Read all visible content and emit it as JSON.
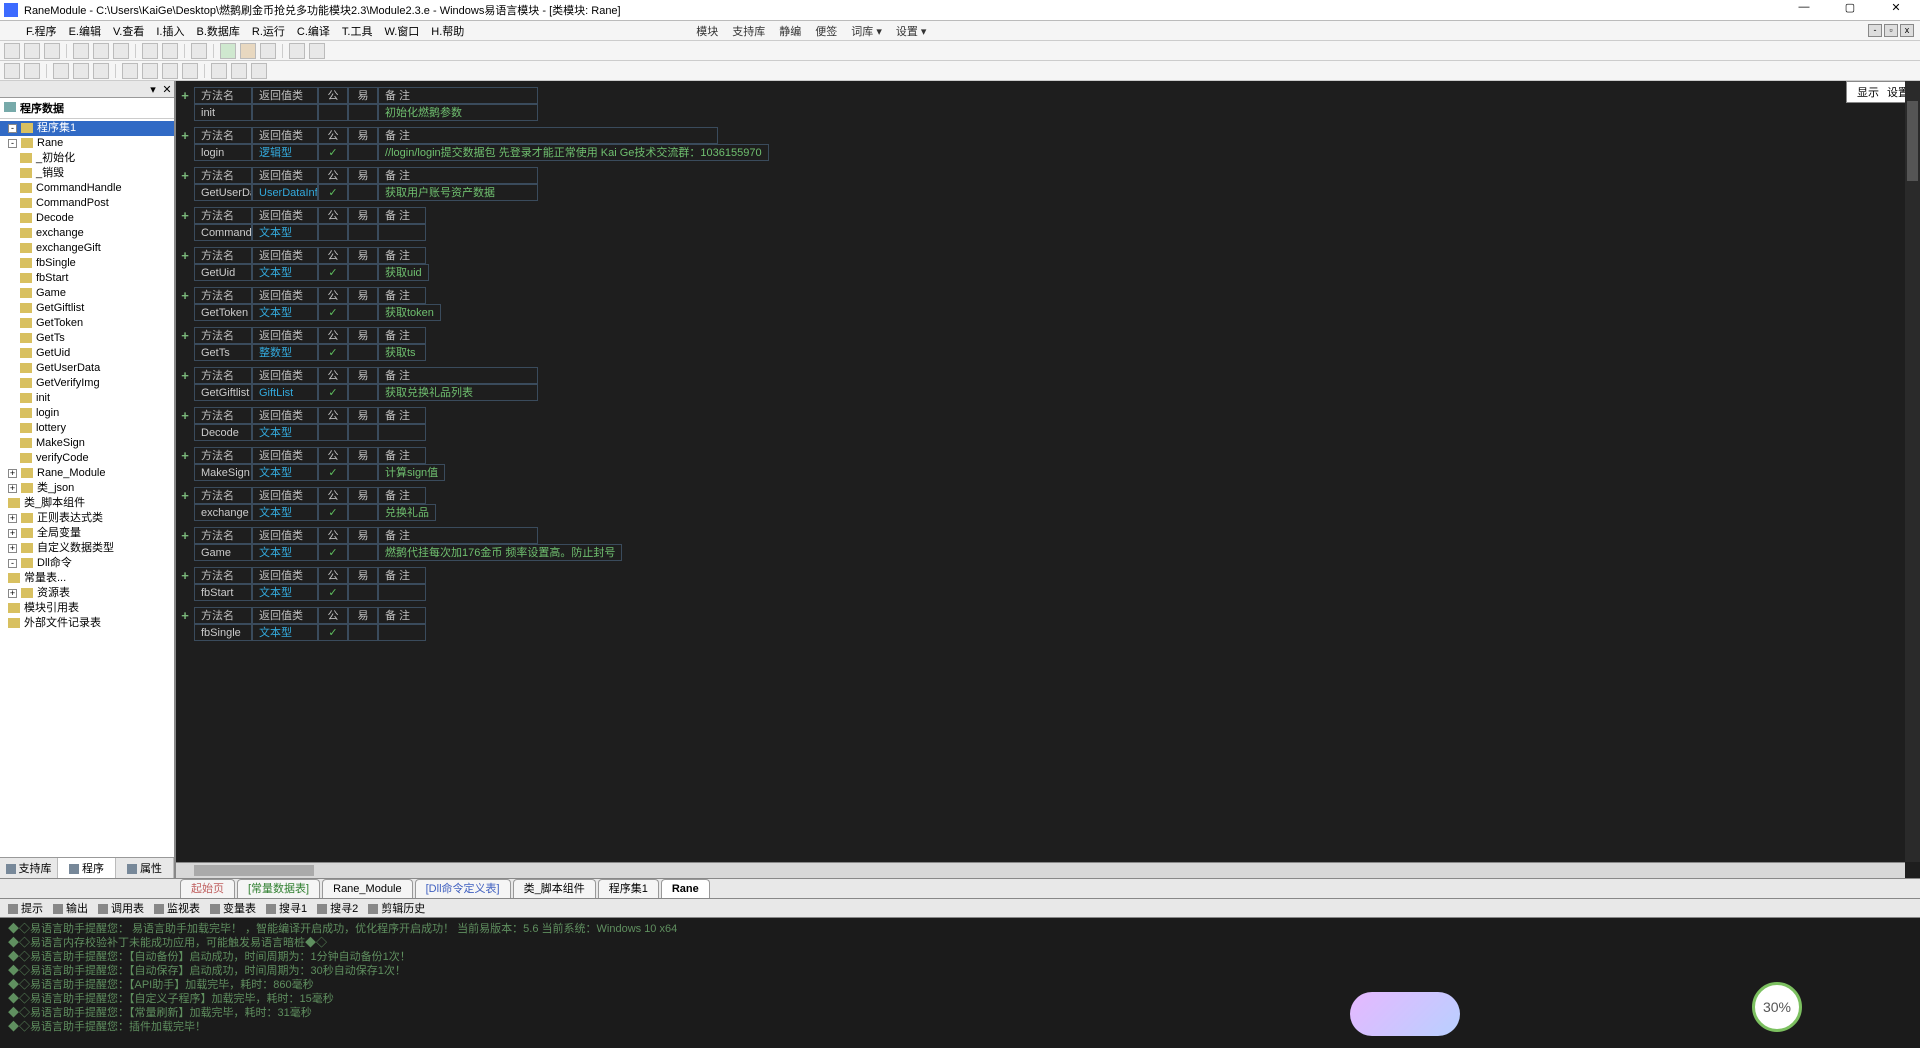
{
  "title": "RaneModule - C:\\Users\\KaiGe\\Desktop\\燃鹅刷金币抢兑多功能模块2.3\\Module2.3.e - Windows易语言模块 - [类模块: Rane]",
  "menu": {
    "items": [
      "F.程序",
      "E.编辑",
      "V.查看",
      "I.插入",
      "B.数据库",
      "R.运行",
      "C.编译",
      "T.工具",
      "W.窗口",
      "H.帮助"
    ],
    "items2": [
      "模块",
      "支持库",
      "静编",
      "便签",
      "词库 ▾",
      "设置 ▾"
    ]
  },
  "sysbtns": {
    "min": "—",
    "max": "▢",
    "close": "✕"
  },
  "side": {
    "title": "程序数据",
    "tabs": [
      "支持库",
      "程序",
      "属性"
    ],
    "tree": [
      {
        "lv": 0,
        "pm": "-",
        "t": "程序集1",
        "sel": true
      },
      {
        "lv": 0,
        "pm": "-",
        "t": "Rane"
      },
      {
        "lv": 1,
        "t": "_初始化"
      },
      {
        "lv": 1,
        "t": "_销毁"
      },
      {
        "lv": 1,
        "t": "CommandHandle"
      },
      {
        "lv": 1,
        "t": "CommandPost"
      },
      {
        "lv": 1,
        "t": "Decode"
      },
      {
        "lv": 1,
        "t": "exchange"
      },
      {
        "lv": 1,
        "t": "exchangeGift"
      },
      {
        "lv": 1,
        "t": "fbSingle"
      },
      {
        "lv": 1,
        "t": "fbStart"
      },
      {
        "lv": 1,
        "t": "Game"
      },
      {
        "lv": 1,
        "t": "GetGiftlist"
      },
      {
        "lv": 1,
        "t": "GetToken"
      },
      {
        "lv": 1,
        "t": "GetTs"
      },
      {
        "lv": 1,
        "t": "GetUid"
      },
      {
        "lv": 1,
        "t": "GetUserData"
      },
      {
        "lv": 1,
        "t": "GetVerifyImg"
      },
      {
        "lv": 1,
        "t": "init"
      },
      {
        "lv": 1,
        "t": "login"
      },
      {
        "lv": 1,
        "t": "lottery"
      },
      {
        "lv": 1,
        "t": "MakeSign"
      },
      {
        "lv": 1,
        "t": "verifyCode"
      },
      {
        "lv": 0,
        "pm": "+",
        "t": "Rane_Module"
      },
      {
        "lv": 0,
        "pm": "+",
        "t": "类_json"
      },
      {
        "lv": 0,
        "pm": "",
        "t": "类_脚本组件"
      },
      {
        "lv": 0,
        "pm": "+",
        "t": "正则表达式类"
      },
      {
        "lv": 0,
        "pm": "+",
        "t": "全局变量"
      },
      {
        "lv": 0,
        "pm": "+",
        "t": "自定义数据类型"
      },
      {
        "lv": 0,
        "pm": "-",
        "t": "Dll命令"
      },
      {
        "lv": 0,
        "pm": "",
        "t": "常量表..."
      },
      {
        "lv": 0,
        "pm": "+",
        "t": "资源表"
      },
      {
        "lv": 0,
        "pm": "",
        "t": "模块引用表"
      },
      {
        "lv": 0,
        "pm": "",
        "t": "外部文件记录表"
      }
    ]
  },
  "ed": {
    "btn1": "显示",
    "btn2": "设置",
    "hdr": {
      "name": "方法名",
      "ret": "返回值类型",
      "pub": "公开",
      "pkg": "易包",
      "note": "备 注"
    },
    "methods": [
      {
        "name": "init",
        "ret": "",
        "pub": "",
        "note": "初始化燃鹅参数",
        "nw": "note-wide"
      },
      {
        "name": "login",
        "ret": "逻辑型",
        "pub": "✓",
        "note": "//login/login提交数据包 先登录才能正常使用  Kai Ge技术交流群：1036155970",
        "nw": "note-xwide"
      },
      {
        "name": "GetUserData",
        "ret": "UserDataInfo",
        "pub": "✓",
        "note": "获取用户账号资产数据",
        "nw": "note-wide"
      },
      {
        "name": "CommandPost",
        "ret": "文本型",
        "pub": "",
        "note": ""
      },
      {
        "name": "GetUid",
        "ret": "文本型",
        "pub": "✓",
        "note": "获取uid"
      },
      {
        "name": "GetToken",
        "ret": "文本型",
        "pub": "✓",
        "note": "获取token"
      },
      {
        "name": "GetTs",
        "ret": "整数型",
        "pub": "✓",
        "note": "获取ts"
      },
      {
        "name": "GetGiftlist",
        "ret": "GiftList",
        "pub": "✓",
        "note": "获取兑换礼品列表",
        "nw": "note-wide"
      },
      {
        "name": "Decode",
        "ret": "文本型",
        "pub": "",
        "note": ""
      },
      {
        "name": "MakeSign",
        "ret": "文本型",
        "pub": "✓",
        "note": "计算sign值"
      },
      {
        "name": "exchange",
        "ret": "文本型",
        "pub": "✓",
        "note": "兑换礼品"
      },
      {
        "name": "Game",
        "ret": "文本型",
        "pub": "✓",
        "note": "燃鹅代挂每次加176金币 频率设置高。防止封号",
        "nw": "note-wide"
      },
      {
        "name": "fbStart",
        "ret": "文本型",
        "pub": "✓",
        "note": ""
      },
      {
        "name": "fbSingle",
        "ret": "文本型",
        "pub": "✓",
        "note": ""
      }
    ]
  },
  "tabs": [
    {
      "t": "起始页",
      "c": "red"
    },
    {
      "t": "[常量数据表]",
      "c": "green"
    },
    {
      "t": "Rane_Module",
      "c": ""
    },
    {
      "t": "[Dll命令定义表]",
      "c": "blue"
    },
    {
      "t": "类_脚本组件",
      "c": ""
    },
    {
      "t": "程序集1",
      "c": ""
    },
    {
      "t": "Rane",
      "c": "",
      "active": true
    }
  ],
  "tooltabs": [
    "提示",
    "输出",
    "调用表",
    "监视表",
    "变量表",
    "搜寻1",
    "搜寻2",
    "剪辑历史"
  ],
  "output": [
    "◆◇易语言助手提醒您：  易语言助手加载完毕！ ，智能编译开启成功，优化程序开启成功！  当前易版本：5.6  当前系统：Windows 10 x64",
    "",
    "◆◇易语言内存校验补丁未能成功应用，可能触发易语言暗桩◆◇",
    "",
    "◆◇易语言助手提醒您：【自动备份】启动成功，时间周期为：1分钟自动备份1次！",
    "◆◇易语言助手提醒您：【自动保存】启动成功，时间周期为：30秒自动保存1次！",
    "◆◇易语言助手提醒您：【API助手】加载完毕，耗时：860毫秒",
    "◆◇易语言助手提醒您：【自定义子程序】加载完毕，耗时：15毫秒",
    "◆◇易语言助手提醒您：【常量刷新】加载完毕，耗时：31毫秒",
    "◆◇易语言助手提醒您：插件加载完毕！"
  ],
  "badge": "30%"
}
